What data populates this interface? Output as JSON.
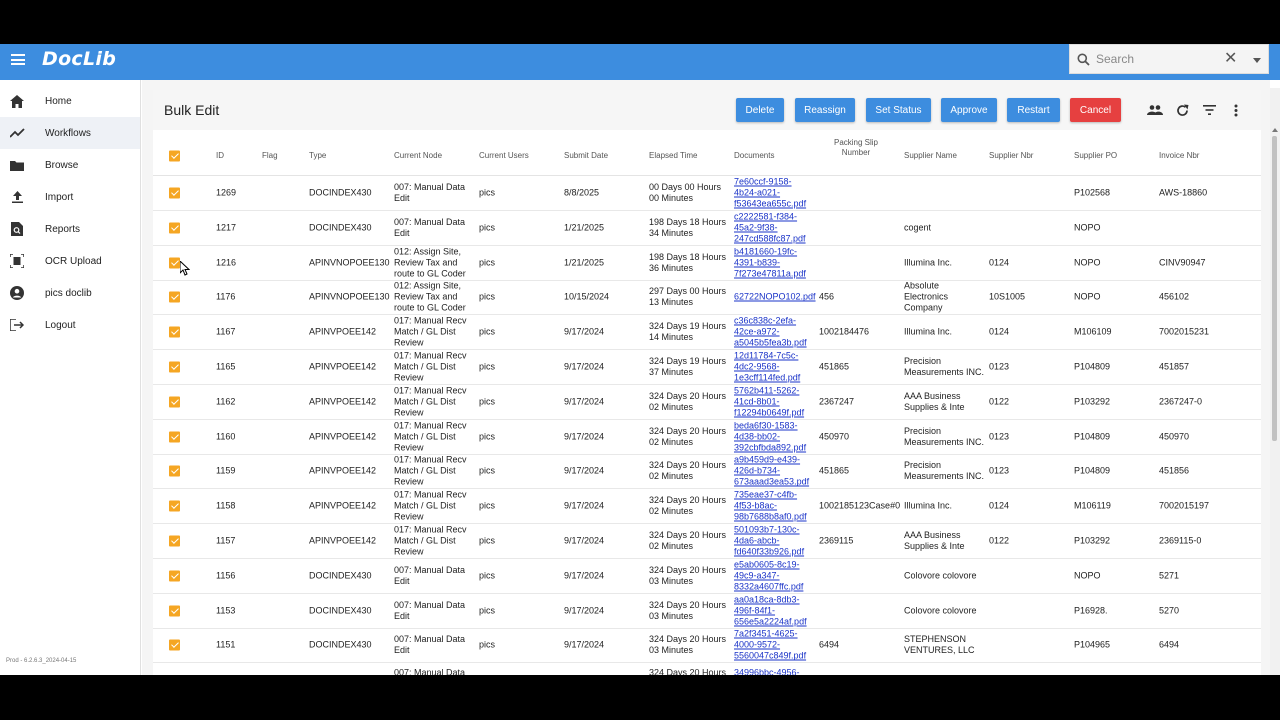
{
  "app": {
    "logo": "DocLib",
    "search_placeholder": "Search",
    "version": "Prod - 6.2.6.3_2024-04-15"
  },
  "sidebar": {
    "items": [
      {
        "label": "Home",
        "icon": "home-icon"
      },
      {
        "label": "Workflows",
        "icon": "trending-up-icon",
        "active": true
      },
      {
        "label": "Browse",
        "icon": "folder-icon"
      },
      {
        "label": "Import",
        "icon": "upload-icon"
      },
      {
        "label": "Reports",
        "icon": "report-search-icon"
      },
      {
        "label": "OCR Upload",
        "icon": "document-scanner-icon"
      },
      {
        "label": "pics doclib",
        "icon": "account-circle-icon"
      },
      {
        "label": "Logout",
        "icon": "logout-icon"
      }
    ]
  },
  "page": {
    "title": "Bulk Edit",
    "buttons": {
      "delete": "Delete",
      "reassign": "Reassign",
      "set_status": "Set Status",
      "approve": "Approve",
      "restart": "Restart",
      "cancel": "Cancel"
    }
  },
  "table": {
    "columns": [
      "ID",
      "Flag",
      "Type",
      "Current Node",
      "Current Users",
      "Submit Date",
      "Elapsed Time",
      "Documents",
      "Packing Slip Number",
      "Supplier Name",
      "Supplier Nbr",
      "Supplier PO",
      "Invoice Nbr"
    ],
    "rows": [
      {
        "id": "1269",
        "flag": "",
        "type": "DOCINDEX430",
        "node": [
          "007: Manual Data",
          "Edit"
        ],
        "users": "pics",
        "date": "8/8/2025",
        "elapsed": [
          "00 Days 00 Hours",
          "00 Minutes"
        ],
        "doc": [
          "7e60ccf-9158-",
          "4b24-a021-",
          "f53643ea655c.pdf"
        ],
        "packing": "",
        "supplier": [
          ""
        ],
        "nbr": "",
        "po": "P102568",
        "invoice": "AWS-18860"
      },
      {
        "id": "1217",
        "flag": "",
        "type": "DOCINDEX430",
        "node": [
          "007: Manual Data",
          "Edit"
        ],
        "users": "pics",
        "date": "1/21/2025",
        "elapsed": [
          "198 Days 18 Hours",
          "34 Minutes"
        ],
        "doc": [
          "c2222581-f384-",
          "45a2-9f38-",
          "247cd588fc87.pdf"
        ],
        "packing": "",
        "supplier": [
          "cogent"
        ],
        "nbr": "",
        "po": "NOPO",
        "invoice": ""
      },
      {
        "id": "1216",
        "flag": "",
        "type": "APINVNOPOEE130",
        "node": [
          "012: Assign Site,",
          "Review Tax and",
          "route to GL Coder"
        ],
        "users": "pics",
        "date": "1/21/2025",
        "elapsed": [
          "198 Days 18 Hours",
          "36 Minutes"
        ],
        "doc": [
          "b4181660-19fc-",
          "4391-b839-",
          "7f273e47811a.pdf"
        ],
        "packing": "",
        "supplier": [
          "Illumina Inc."
        ],
        "nbr": "0124",
        "po": "NOPO",
        "invoice": "CINV90947"
      },
      {
        "id": "1176",
        "flag": "",
        "type": "APINVNOPOEE130",
        "node": [
          "012: Assign Site,",
          "Review Tax and",
          "route to GL Coder"
        ],
        "users": "pics",
        "date": "10/15/2024",
        "elapsed": [
          "297 Days 00 Hours",
          "13 Minutes"
        ],
        "doc": [
          "62722NOPO102.pdf"
        ],
        "packing": "456",
        "supplier": [
          "Absolute",
          "Electronics",
          "Company"
        ],
        "nbr": "10S1005",
        "po": "NOPO",
        "invoice": "456102"
      },
      {
        "id": "1167",
        "flag": "",
        "type": "APINVPOEE142",
        "node": [
          "017: Manual Recv",
          "Match / GL Dist",
          "Review"
        ],
        "users": "pics",
        "date": "9/17/2024",
        "elapsed": [
          "324 Days 19 Hours",
          "14 Minutes"
        ],
        "doc": [
          "c36c838c-2efa-",
          "42ce-a972-",
          "a5045b5fea3b.pdf"
        ],
        "packing": "1002184476",
        "supplier": [
          "Illumina Inc."
        ],
        "nbr": "0124",
        "po": "M106109",
        "invoice": "7002015231"
      },
      {
        "id": "1165",
        "flag": "",
        "type": "APINVPOEE142",
        "node": [
          "017: Manual Recv",
          "Match / GL Dist",
          "Review"
        ],
        "users": "pics",
        "date": "9/17/2024",
        "elapsed": [
          "324 Days 19 Hours",
          "37 Minutes"
        ],
        "doc": [
          "12d11784-7c5c-",
          "4dc2-9568-",
          "1e3cff114fed.pdf"
        ],
        "packing": "451865",
        "supplier": [
          "Precision",
          "Measurements INC."
        ],
        "nbr": "0123",
        "po": "P104809",
        "invoice": "451857"
      },
      {
        "id": "1162",
        "flag": "",
        "type": "APINVPOEE142",
        "node": [
          "017: Manual Recv",
          "Match / GL Dist",
          "Review"
        ],
        "users": "pics",
        "date": "9/17/2024",
        "elapsed": [
          "324 Days 20 Hours",
          "02 Minutes"
        ],
        "doc": [
          "5762b411-5262-",
          "41cd-8b01-",
          "f12294b0649f.pdf"
        ],
        "packing": "2367247",
        "supplier": [
          "AAA Business",
          "Supplies & Inte"
        ],
        "nbr": "0122",
        "po": "P103292",
        "invoice": "2367247-0"
      },
      {
        "id": "1160",
        "flag": "",
        "type": "APINVPOEE142",
        "node": [
          "017: Manual Recv",
          "Match / GL Dist",
          "Review"
        ],
        "users": "pics",
        "date": "9/17/2024",
        "elapsed": [
          "324 Days 20 Hours",
          "02 Minutes"
        ],
        "doc": [
          "beda6f30-1583-",
          "4d38-bb02-",
          "392cbfbda892.pdf"
        ],
        "packing": "450970",
        "supplier": [
          "Precision",
          "Measurements INC."
        ],
        "nbr": "0123",
        "po": "P104809",
        "invoice": "450970"
      },
      {
        "id": "1159",
        "flag": "",
        "type": "APINVPOEE142",
        "node": [
          "017: Manual Recv",
          "Match / GL Dist",
          "Review"
        ],
        "users": "pics",
        "date": "9/17/2024",
        "elapsed": [
          "324 Days 20 Hours",
          "02 Minutes"
        ],
        "doc": [
          "a9b459d9-e439-",
          "426d-b734-",
          "673aaad3ea53.pdf"
        ],
        "packing": "451865",
        "supplier": [
          "Precision",
          "Measurements INC."
        ],
        "nbr": "0123",
        "po": "P104809",
        "invoice": "451856"
      },
      {
        "id": "1158",
        "flag": "",
        "type": "APINVPOEE142",
        "node": [
          "017: Manual Recv",
          "Match / GL Dist",
          "Review"
        ],
        "users": "pics",
        "date": "9/17/2024",
        "elapsed": [
          "324 Days 20 Hours",
          "02 Minutes"
        ],
        "doc": [
          "735eae37-c4fb-",
          "4f53-b8ac-",
          "98b7688b8af0.pdf"
        ],
        "packing": "1002185123Case#0",
        "supplier": [
          "Illumina Inc."
        ],
        "nbr": "0124",
        "po": "M106119",
        "invoice": "7002015197"
      },
      {
        "id": "1157",
        "flag": "",
        "type": "APINVPOEE142",
        "node": [
          "017: Manual Recv",
          "Match / GL Dist",
          "Review"
        ],
        "users": "pics",
        "date": "9/17/2024",
        "elapsed": [
          "324 Days 20 Hours",
          "02 Minutes"
        ],
        "doc": [
          "501093b7-130c-",
          "4da6-abcb-",
          "fd640f33b926.pdf"
        ],
        "packing": "2369115",
        "supplier": [
          "AAA Business",
          "Supplies & Inte"
        ],
        "nbr": "0122",
        "po": "P103292",
        "invoice": "2369115-0"
      },
      {
        "id": "1156",
        "flag": "",
        "type": "DOCINDEX430",
        "node": [
          "007: Manual Data",
          "Edit"
        ],
        "users": "pics",
        "date": "9/17/2024",
        "elapsed": [
          "324 Days 20 Hours",
          "03 Minutes"
        ],
        "doc": [
          "e5ab0605-8c19-",
          "49c9-a347-",
          "8332a4607ffc.pdf"
        ],
        "packing": "",
        "supplier": [
          "Colovore colovore"
        ],
        "nbr": "",
        "po": "NOPO",
        "invoice": "5271"
      },
      {
        "id": "1153",
        "flag": "",
        "type": "DOCINDEX430",
        "node": [
          "007: Manual Data",
          "Edit"
        ],
        "users": "pics",
        "date": "9/17/2024",
        "elapsed": [
          "324 Days 20 Hours",
          "03 Minutes"
        ],
        "doc": [
          "aa0a18ca-8db3-",
          "496f-84f1-",
          "656e5a2224af.pdf"
        ],
        "packing": "",
        "supplier": [
          "Colovore colovore"
        ],
        "nbr": "",
        "po": "P16928.",
        "invoice": "5270"
      },
      {
        "id": "1151",
        "flag": "",
        "type": "DOCINDEX430",
        "node": [
          "007: Manual Data",
          "Edit"
        ],
        "users": "pics",
        "date": "9/17/2024",
        "elapsed": [
          "324 Days 20 Hours",
          "03 Minutes"
        ],
        "doc": [
          "7a2f3451-4625-",
          "4000-9572-",
          "5560047c849f.pdf"
        ],
        "packing": "6494",
        "supplier": [
          "STEPHENSON",
          "VENTURES, LLC"
        ],
        "nbr": "",
        "po": "P104965",
        "invoice": "6494"
      },
      {
        "id": "",
        "flag": "",
        "type": "",
        "node": [
          "007: Manual Data"
        ],
        "users": "",
        "date": "",
        "elapsed": [
          "324 Days 20 Hours"
        ],
        "doc": [
          "34996bbc-4956-"
        ],
        "packing": "",
        "supplier": [
          ""
        ],
        "nbr": "",
        "po": "",
        "invoice": ""
      }
    ]
  },
  "colors": {
    "topbar": "#3d8ddf",
    "button": "#3d8ddf",
    "cancel": "#e64040",
    "checkbox": "#f5a623",
    "link": "#1a33c8"
  }
}
